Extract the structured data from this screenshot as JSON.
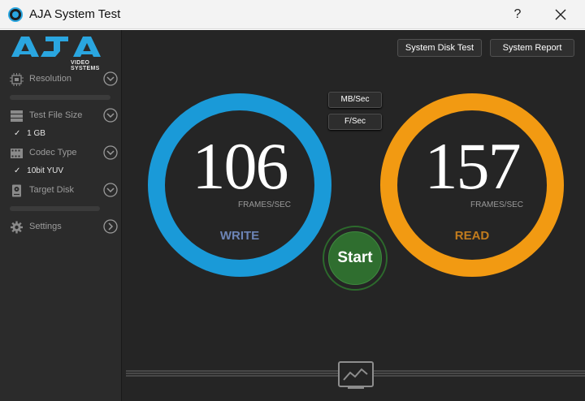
{
  "window": {
    "title": "AJA System Test",
    "help_label": "?",
    "icon": "aja-app-icon",
    "close_icon": "close-icon"
  },
  "logo": {
    "brand": "AJA",
    "subtitle": "VIDEO SYSTEMS",
    "brand_color": "#2aa6e0"
  },
  "sidebar": {
    "items": [
      {
        "label": "Resolution",
        "icon": "chip-icon",
        "chevron": "chevron-down-icon"
      },
      {
        "label": "Test File Size",
        "icon": "stack-icon",
        "chevron": "chevron-down-icon",
        "value": "1 GB"
      },
      {
        "label": "Codec Type",
        "icon": "film-icon",
        "chevron": "chevron-down-icon",
        "value": "10bit YUV"
      },
      {
        "label": "Target Disk",
        "icon": "disk-icon",
        "chevron": "chevron-down-icon"
      },
      {
        "label": "Settings",
        "icon": "gear-icon",
        "chevron": "chevron-right-icon"
      }
    ],
    "check_mark": "✓"
  },
  "toolbar": {
    "disk_test_label": "System Disk Test",
    "report_label": "System Report"
  },
  "units": {
    "mbsec_label": "MB/Sec",
    "fsec_label": "F/Sec"
  },
  "write_gauge": {
    "value": "106",
    "unit": "FRAMES/SEC",
    "label": "WRITE",
    "color": "#1a9ad8"
  },
  "read_gauge": {
    "value": "157",
    "unit": "FRAMES/SEC",
    "label": "READ",
    "color": "#f29a12"
  },
  "start": {
    "label": "Start",
    "color": "#2f6e2f"
  },
  "graph_toggle": {
    "icon": "chart-icon"
  }
}
